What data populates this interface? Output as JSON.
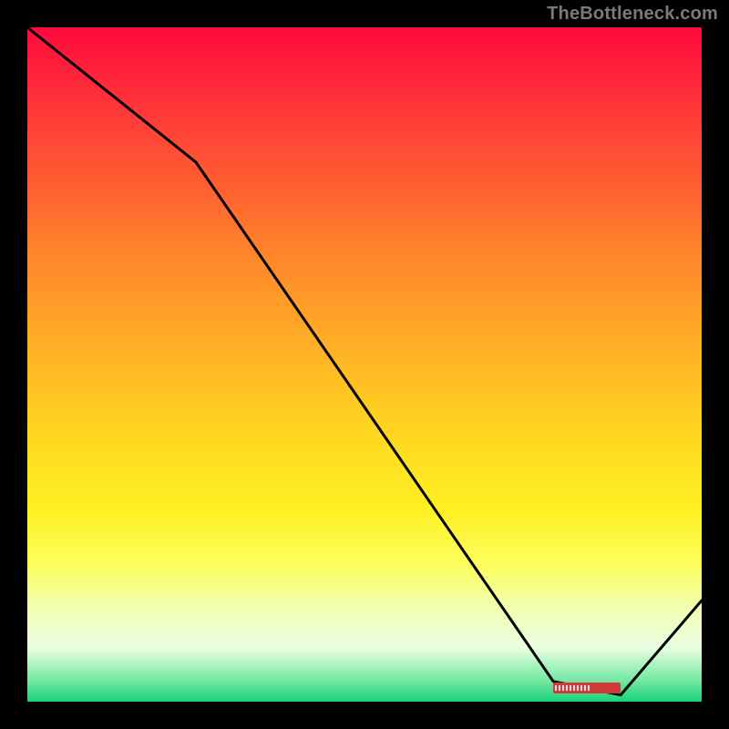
{
  "watermark": "TheBottleneck.com",
  "chart_data": {
    "type": "line",
    "title": "",
    "xlabel": "",
    "ylabel": "",
    "xlim": [
      0,
      100
    ],
    "ylim": [
      0,
      100
    ],
    "grid": false,
    "legend": false,
    "background_gradient": {
      "top_color": "#ff0a3c",
      "bottom_color": "#19d27a",
      "description": "vertical red→orange→yellow→green gradient"
    },
    "series": [
      {
        "name": "curve",
        "color": "#000000",
        "x": [
          0,
          25,
          78,
          88,
          100
        ],
        "values": [
          100,
          80,
          3,
          1,
          15
        ]
      }
    ],
    "marker": {
      "x_start": 78,
      "x_end": 88,
      "y": 2,
      "color": "#d23a3a"
    }
  }
}
